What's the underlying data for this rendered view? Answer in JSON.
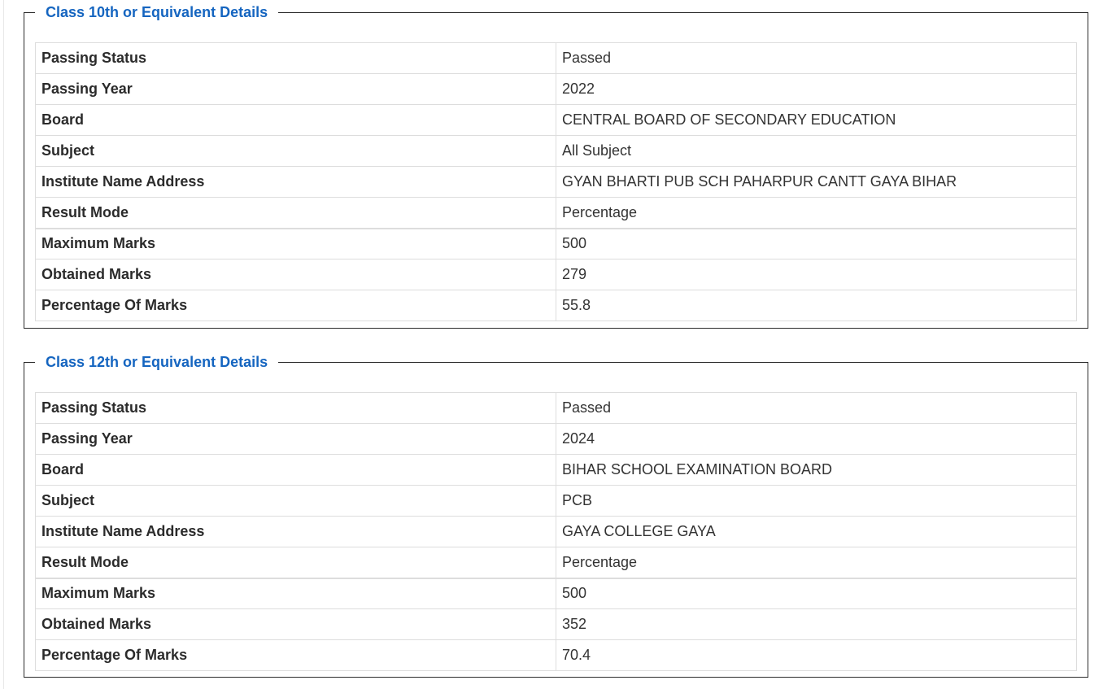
{
  "class10": {
    "legend": "Class 10th or Equivalent Details",
    "rows": [
      {
        "label": "Passing Status",
        "value": "Passed"
      },
      {
        "label": "Passing Year",
        "value": "2022"
      },
      {
        "label": "Board",
        "value": "CENTRAL BOARD OF SECONDARY EDUCATION"
      },
      {
        "label": "Subject",
        "value": "All Subject"
      },
      {
        "label": "Institute Name Address",
        "value": "GYAN BHARTI PUB SCH PAHARPUR CANTT GAYA BIHAR"
      },
      {
        "label": "Result Mode",
        "value": "Percentage"
      },
      {
        "label": "Maximum Marks",
        "value": "500"
      },
      {
        "label": "Obtained Marks",
        "value": "279"
      },
      {
        "label": "Percentage Of Marks",
        "value": "55.8"
      }
    ]
  },
  "class12": {
    "legend": "Class 12th or Equivalent Details",
    "rows": [
      {
        "label": "Passing Status",
        "value": "Passed"
      },
      {
        "label": "Passing Year",
        "value": "2024"
      },
      {
        "label": "Board",
        "value": "BIHAR SCHOOL EXAMINATION BOARD"
      },
      {
        "label": "Subject",
        "value": "PCB"
      },
      {
        "label": "Institute Name Address",
        "value": "GAYA COLLEGE GAYA"
      },
      {
        "label": "Result Mode",
        "value": "Percentage"
      },
      {
        "label": "Maximum Marks",
        "value": "500"
      },
      {
        "label": "Obtained Marks",
        "value": "352"
      },
      {
        "label": "Percentage Of Marks",
        "value": "70.4"
      }
    ]
  }
}
